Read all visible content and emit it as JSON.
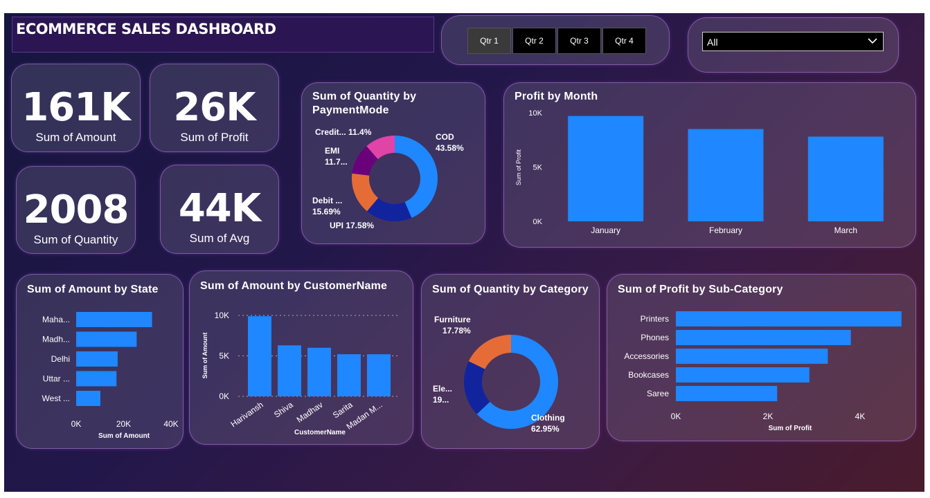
{
  "header": {
    "title": "ECOMMERCE SALES DASHBOARD"
  },
  "quarters": {
    "items": [
      "Qtr 1",
      "Qtr 2",
      "Qtr 3",
      "Qtr 4"
    ],
    "selected": "Qtr 1"
  },
  "filter": {
    "value": "All"
  },
  "kpis": {
    "amount": {
      "value": "161K",
      "label": "Sum of Amount"
    },
    "profit": {
      "value": "26K",
      "label": "Sum of Profit"
    },
    "quantity": {
      "value": "2008",
      "label": "Sum of Quantity"
    },
    "avg": {
      "value": "44K",
      "label": "Sum of Avg"
    }
  },
  "colors": {
    "bar": "#1f87ff",
    "cod": "#1f87ff",
    "upi": "#12239e",
    "debit": "#e66c37",
    "emi": "#6b007b",
    "credit": "#e044a7",
    "clothing": "#1f87ff",
    "electronics": "#12239e",
    "furniture": "#e66c37"
  },
  "chart_data": [
    {
      "id": "payment",
      "type": "pie",
      "title": "Sum of Quantity by PaymentMode",
      "slices": [
        {
          "label": "COD",
          "value": 43.58,
          "pct_text": "43.58%"
        },
        {
          "label": "UPI",
          "value": 17.58,
          "pct_text": "17.58%"
        },
        {
          "label": "Debit ...",
          "value": 15.69,
          "pct_text": "15.69%"
        },
        {
          "label": "EMI",
          "value": 11.75,
          "pct_text": "11.7..."
        },
        {
          "label": "Credit...",
          "value": 11.4,
          "pct_text": "11.4%"
        }
      ]
    },
    {
      "id": "month",
      "type": "bar",
      "title": "Profit by Month",
      "categories": [
        "January",
        "February",
        "March"
      ],
      "values": [
        9700,
        8500,
        7800
      ],
      "ylabel": "Sum of Profit",
      "yticks": [
        "0K",
        "5K",
        "10K"
      ],
      "ylim": [
        0,
        10000
      ]
    },
    {
      "id": "state",
      "type": "bar",
      "orientation": "horizontal",
      "title": "Sum of Amount by State",
      "categories": [
        "Maha...",
        "Madh...",
        "Delhi",
        "Uttar ...",
        "West ..."
      ],
      "values": [
        32000,
        25500,
        17500,
        17000,
        10200
      ],
      "xlabel": "Sum of Amount",
      "xticks": [
        "0K",
        "20K",
        "40K"
      ],
      "xlim": [
        0,
        40000
      ]
    },
    {
      "id": "customer",
      "type": "bar",
      "title": "Sum of Amount by CustomerName",
      "categories": [
        "Harivansh",
        "Shiva",
        "Madhav",
        "Sarita",
        "Madan M..."
      ],
      "values": [
        9900,
        6300,
        6000,
        5200,
        5200
      ],
      "xlabel": "CustomerName",
      "ylabel": "Sum of Amount",
      "yticks": [
        "0K",
        "5K",
        "10K"
      ],
      "ylim": [
        0,
        10000
      ]
    },
    {
      "id": "category",
      "type": "pie",
      "title": "Sum of Quantity by Category",
      "slices": [
        {
          "label": "Clothing",
          "value": 62.95,
          "pct_text": "62.95%"
        },
        {
          "label": "Ele...",
          "value": 19.27,
          "pct_text": "19..."
        },
        {
          "label": "Furniture",
          "value": 17.78,
          "pct_text": "17.78%"
        }
      ]
    },
    {
      "id": "subcat",
      "type": "bar",
      "orientation": "horizontal",
      "title": "Sum of Profit by Sub-Category",
      "categories": [
        "Printers",
        "Phones",
        "Accessories",
        "Bookcases",
        "Saree"
      ],
      "values": [
        4900,
        3800,
        3300,
        2900,
        2200
      ],
      "xlabel": "Sum of Profit",
      "xticks": [
        "0K",
        "2K",
        "4K"
      ],
      "xlim": [
        0,
        4000
      ]
    }
  ]
}
